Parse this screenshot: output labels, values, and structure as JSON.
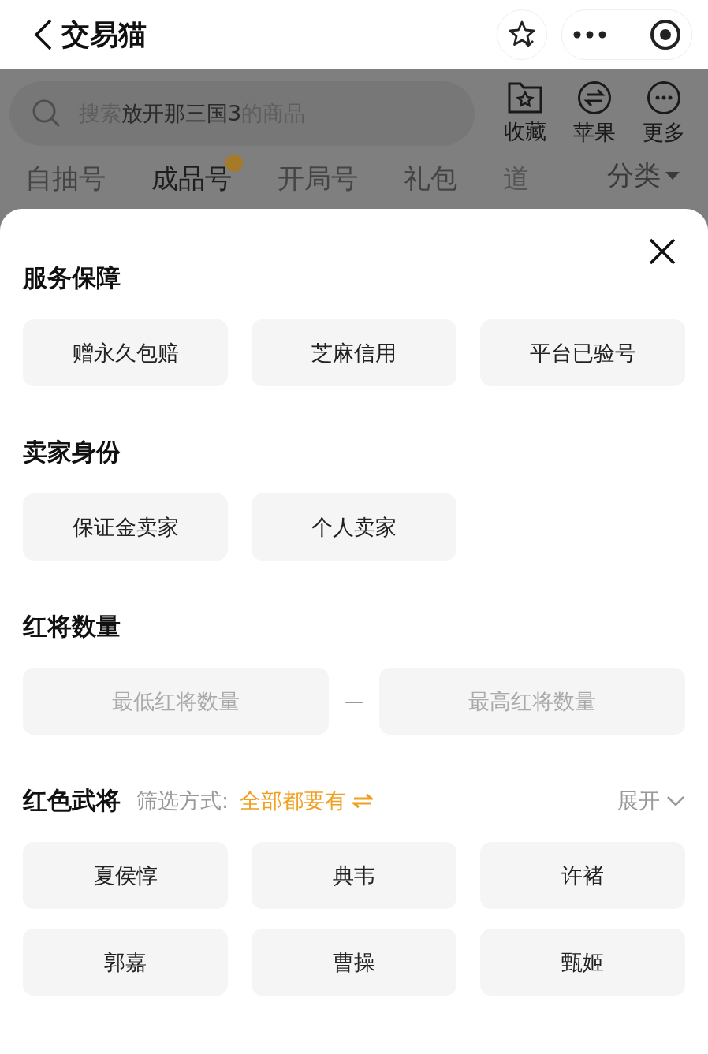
{
  "nav": {
    "title": "交易猫"
  },
  "search": {
    "placeholder_prefix": "搜索",
    "keyword": "放开那三国3",
    "placeholder_suffix": "的商品"
  },
  "actions": [
    {
      "kind": "favorite",
      "label": "收藏"
    },
    {
      "kind": "swap",
      "label": "苹果"
    },
    {
      "kind": "more",
      "label": "更多"
    }
  ],
  "tabs": [
    {
      "label": "自抽号",
      "selected": false,
      "badge": false,
      "faded": false
    },
    {
      "label": "成品号",
      "selected": true,
      "badge": true,
      "faded": false
    },
    {
      "label": "开局号",
      "selected": false,
      "badge": false,
      "faded": false
    },
    {
      "label": "礼包",
      "selected": false,
      "badge": false,
      "faded": false
    },
    {
      "label": "道",
      "selected": false,
      "badge": false,
      "faded": true
    }
  ],
  "category": {
    "label": "分类"
  },
  "sections": [
    {
      "kind": "chips",
      "title": "服务保障",
      "options": [
        "赠永久包赔",
        "芝麻信用",
        "平台已验号"
      ]
    },
    {
      "kind": "chips",
      "title": "卖家身份",
      "options": [
        "保证金卖家",
        "个人卖家"
      ]
    },
    {
      "kind": "range",
      "title": "红将数量",
      "min_placeholder": "最低红将数量",
      "separator": "—",
      "max_placeholder": "最高红将数量"
    },
    {
      "kind": "chips",
      "title": "红色武将",
      "filter_label": "筛选方式:",
      "filter_value": "全部都要有",
      "expand": "展开",
      "options": [
        "夏侯惇",
        "典韦",
        "许褚",
        "郭嘉",
        "曹操",
        "甄姬"
      ]
    }
  ]
}
